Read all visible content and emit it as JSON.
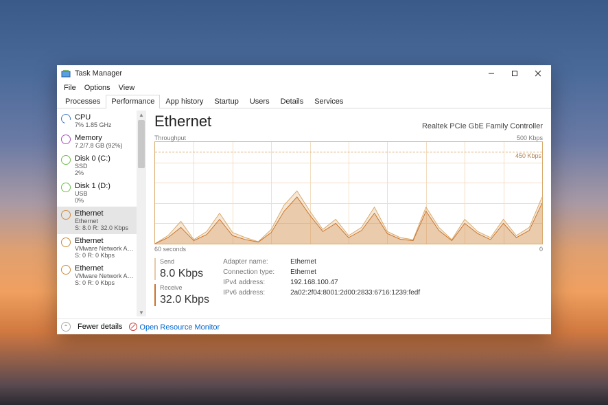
{
  "window": {
    "title": "Task Manager"
  },
  "menubar": [
    "File",
    "Options",
    "View"
  ],
  "tabs": [
    "Processes",
    "Performance",
    "App history",
    "Startup",
    "Users",
    "Details",
    "Services"
  ],
  "active_tab_index": 1,
  "sidebar": {
    "items": [
      {
        "title": "CPU",
        "line2": "7%  1.85 GHz",
        "line3": "",
        "icon": "cpu"
      },
      {
        "title": "Memory",
        "line2": "7.2/7.8 GB (92%)",
        "line3": "",
        "icon": "mem"
      },
      {
        "title": "Disk 0 (C:)",
        "line2": "SSD",
        "line3": "2%",
        "icon": "disk"
      },
      {
        "title": "Disk 1 (D:)",
        "line2": "USB",
        "line3": "0%",
        "icon": "disk"
      },
      {
        "title": "Ethernet",
        "line2": "Ethernet",
        "line3": "S: 8.0 R: 32.0 Kbps",
        "icon": "eth",
        "selected": true
      },
      {
        "title": "Ethernet",
        "line2": "VMware Network Ad...",
        "line3": "S: 0 R: 0 Kbps",
        "icon": "eth"
      },
      {
        "title": "Ethernet",
        "line2": "VMware Network Ad...",
        "line3": "S: 0 R: 0 Kbps",
        "icon": "eth"
      }
    ]
  },
  "main": {
    "title": "Ethernet",
    "subtitle": "Realtek PCIe GbE Family Controller",
    "chart_top_left": "Throughput",
    "chart_top_right": "500 Kbps",
    "chart_dashed_label": "450 Kbps",
    "chart_x_left": "60 seconds",
    "chart_x_right": "0",
    "send_label": "Send",
    "send_value": "8.0 Kbps",
    "recv_label": "Receive",
    "recv_value": "32.0 Kbps",
    "details": {
      "adapter_name_k": "Adapter name:",
      "adapter_name_v": "Ethernet",
      "conn_type_k": "Connection type:",
      "conn_type_v": "Ethernet",
      "ipv4_k": "IPv4 address:",
      "ipv4_v": "192.168.100.47",
      "ipv6_k": "IPv6 address:",
      "ipv6_v": "2a02:2f04:8001:2d00:2833:6716:1239:fedf"
    }
  },
  "footer": {
    "fewer_details": "Fewer details",
    "open_resmon": "Open Resource Monitor"
  },
  "chart_data": {
    "type": "area",
    "xlabel": "60 seconds → 0",
    "ylabel": "Throughput",
    "ylim": [
      0,
      500
    ],
    "unit": "Kbps",
    "dashed_reference": 450,
    "x": [
      0,
      2,
      4,
      6,
      8,
      10,
      12,
      14,
      16,
      18,
      20,
      22,
      24,
      26,
      28,
      30,
      32,
      34,
      36,
      38,
      40,
      42,
      44,
      46,
      48,
      50,
      52,
      54,
      56,
      58,
      60
    ],
    "series": [
      {
        "name": "Send",
        "values": [
          0,
          40,
          110,
          20,
          60,
          150,
          55,
          30,
          10,
          70,
          190,
          260,
          160,
          70,
          120,
          40,
          80,
          180,
          60,
          30,
          20,
          180,
          80,
          20,
          120,
          60,
          30,
          120,
          40,
          80,
          230
        ]
      },
      {
        "name": "Receive",
        "values": [
          0,
          30,
          80,
          15,
          45,
          120,
          40,
          20,
          8,
          55,
          160,
          230,
          140,
          60,
          100,
          30,
          65,
          150,
          50,
          22,
          15,
          160,
          65,
          15,
          100,
          50,
          20,
          100,
          30,
          65,
          200
        ]
      }
    ]
  }
}
